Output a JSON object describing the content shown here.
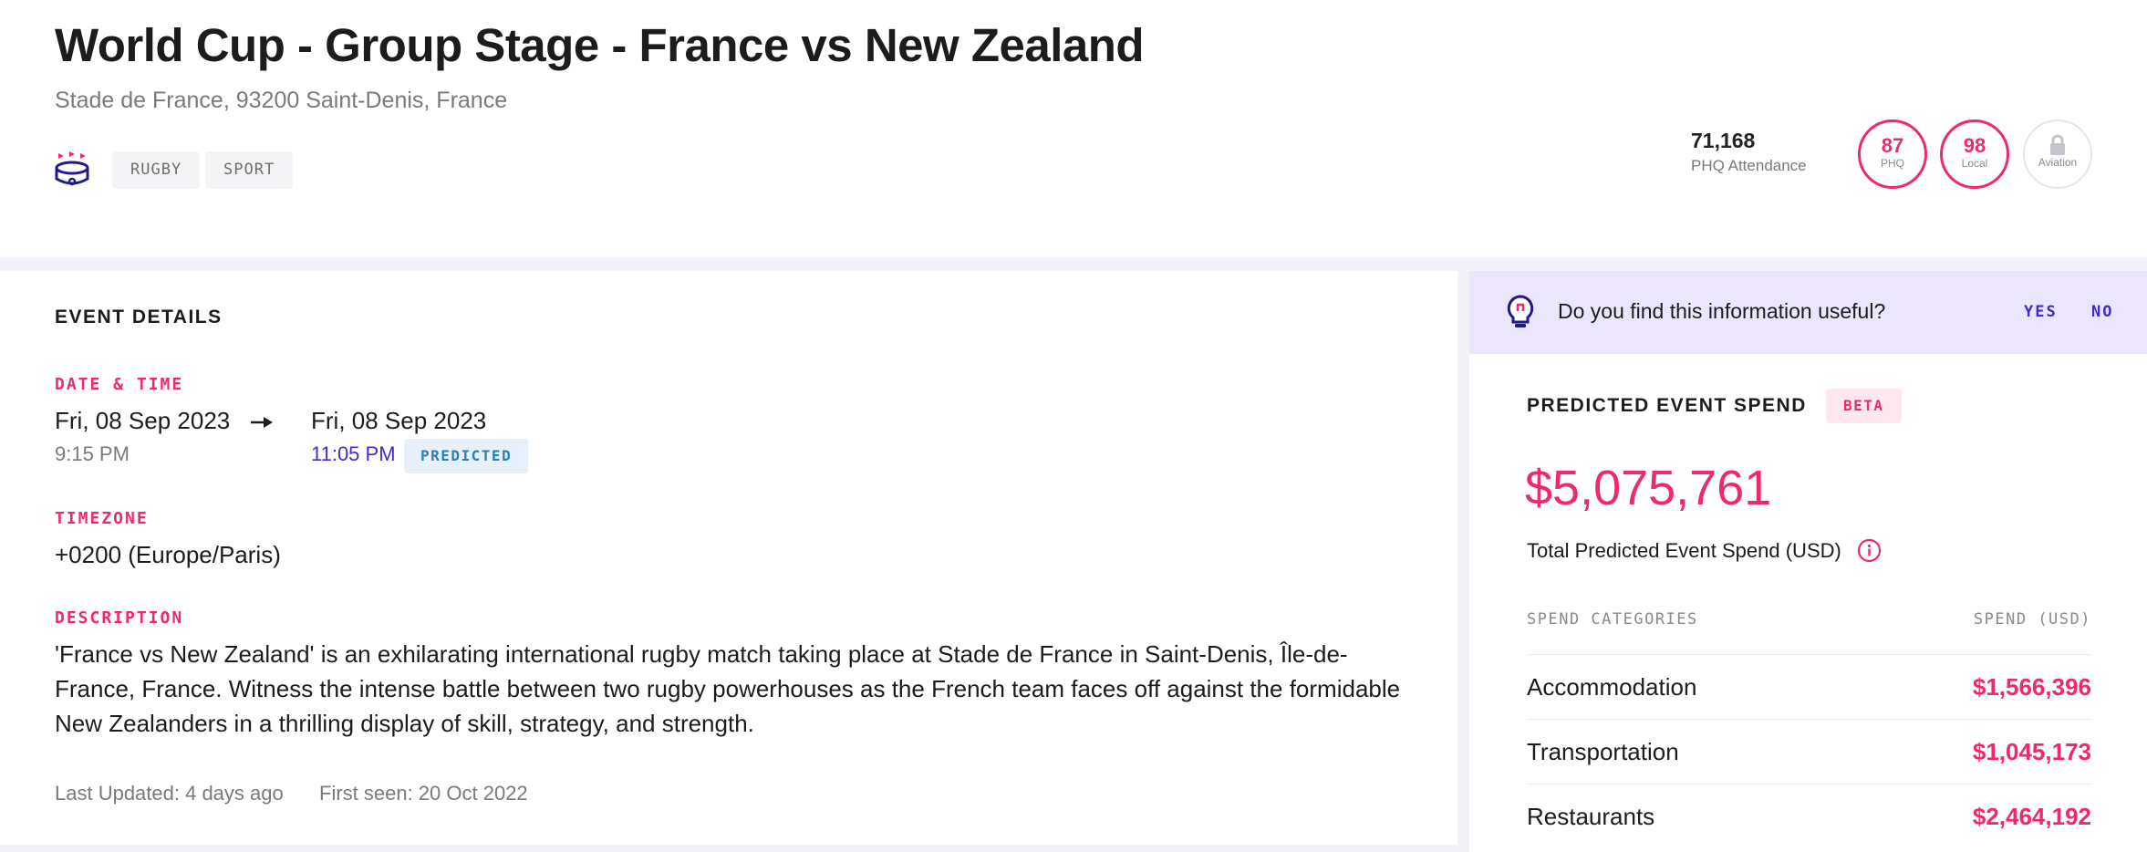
{
  "event": {
    "title": "World Cup - Group Stage - France vs New Zealand",
    "address": "Stade de France, 93200 Saint-Denis, France",
    "tags": [
      "RUGBY",
      "SPORT"
    ],
    "venue_icon": "stadium-icon"
  },
  "stats": {
    "attendance_value": "71,168",
    "attendance_label": "PHQ Attendance",
    "rings": [
      {
        "value": "87",
        "label": "PHQ",
        "score": 87
      },
      {
        "value": "98",
        "label": "Local",
        "score": 98
      },
      {
        "label": "Aviation",
        "icon": "lock-icon"
      }
    ],
    "accent_color": "#ee2a6c"
  },
  "details": {
    "section_title": "EVENT DETAILS",
    "date_time_label": "DATE & TIME",
    "start_date": "Fri, 08 Sep 2023",
    "start_time": "9:15 PM",
    "end_date": "Fri, 08 Sep 2023",
    "end_time": "11:05 PM",
    "predicted_badge": "PREDICTED",
    "timezone_label": "TIMEZONE",
    "timezone": "+0200 (Europe/Paris)",
    "description_label": "DESCRIPTION",
    "description": "'France vs New Zealand' is an exhilarating international rugby match taking place at Stade de France in Saint-Denis, Île-de-France, France. Witness the intense battle between two rugby powerhouses as the French team faces off against the formidable New Zealanders in a thrilling display of skill, strategy, and strength.",
    "last_updated": "Last Updated: 4 days ago",
    "first_seen": "First seen: 20 Oct 2022"
  },
  "feedback": {
    "question": "Do you find this information useful?",
    "yes": "YES",
    "no": "NO",
    "icon": "lightbulb-icon"
  },
  "spend": {
    "title": "PREDICTED EVENT SPEND",
    "beta": "BETA",
    "total": "$5,075,761",
    "caption": "Total Predicted Event Spend (USD)",
    "col_category": "SPEND CATEGORIES",
    "col_spend": "SPEND (USD)",
    "rows": [
      {
        "category": "Accommodation",
        "value": "$1,566,396"
      },
      {
        "category": "Transportation",
        "value": "$1,045,173"
      },
      {
        "category": "Restaurants",
        "value": "$2,464,192"
      }
    ]
  }
}
